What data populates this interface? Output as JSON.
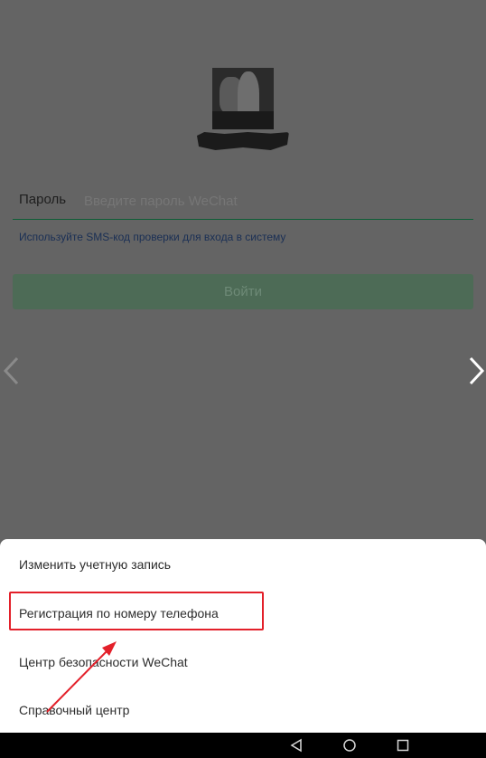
{
  "login": {
    "password_label": "Пароль",
    "password_placeholder": "Введите пароль WeChat",
    "sms_link": "Используйте SMS-код проверки для входа в систему",
    "login_button": "Войти"
  },
  "sheet": {
    "items": [
      {
        "label": "Изменить учетную запись"
      },
      {
        "label": "Регистрация по номеру телефона"
      },
      {
        "label": "Центр безопасности WeChat"
      },
      {
        "label": "Справочный центр"
      }
    ]
  },
  "colors": {
    "highlight": "#e3202a",
    "accent": "#0e5e36"
  },
  "icons": {
    "nav_left": "chevron-left-icon",
    "nav_right": "chevron-right-icon",
    "back": "back-triangle-icon",
    "home": "home-circle-icon",
    "recents": "recents-square-icon"
  }
}
